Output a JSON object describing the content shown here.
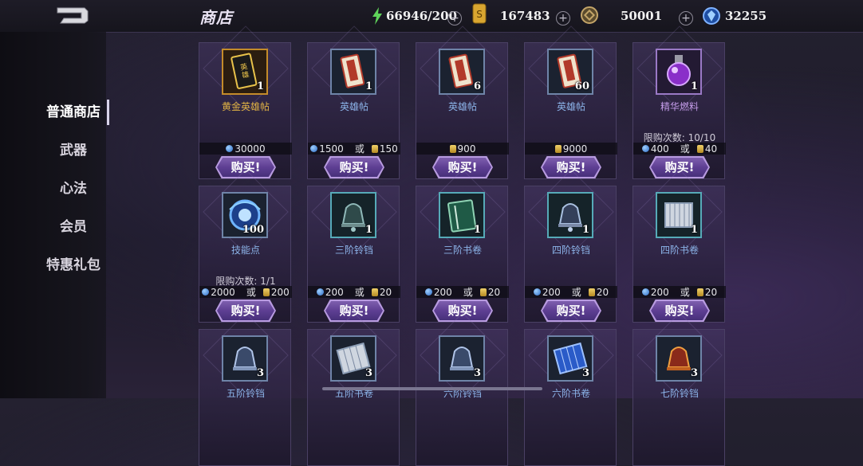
{
  "header": {
    "title": "商店",
    "resources": [
      {
        "icon": "stamina-lightning-icon",
        "value": "66946/200",
        "color": "#5fd35a"
      },
      {
        "icon": "gold-ticket-icon",
        "value": "167483",
        "color": "#d9a630"
      },
      {
        "icon": "copper-coin-icon",
        "value": "50001",
        "color": "#c3a468"
      },
      {
        "icon": "blue-gem-icon",
        "value": "32255",
        "color": "#3a78d8"
      }
    ]
  },
  "sidebar": {
    "items": [
      {
        "label": "普通商店",
        "active": true
      },
      {
        "label": "武器",
        "active": false
      },
      {
        "label": "心法",
        "active": false
      },
      {
        "label": "会员",
        "active": false
      },
      {
        "label": "特惠礼包",
        "active": false
      }
    ]
  },
  "shop": {
    "buy_label": "购买!",
    "or_label": "或",
    "items": [
      {
        "name": "黄金英雄帖",
        "qty": "1",
        "icon": "gold-hero-card-icon",
        "rarity": "gold",
        "limit": "",
        "price_gem": "30000",
        "price_ticket": ""
      },
      {
        "name": "英雄帖",
        "qty": "1",
        "icon": "hero-card-icon",
        "rarity": "blue",
        "limit": "",
        "price_gem": "1500",
        "price_ticket": "150"
      },
      {
        "name": "英雄帖",
        "qty": "6",
        "icon": "hero-card-icon",
        "rarity": "blue",
        "limit": "",
        "price_gem": "",
        "price_ticket": "900"
      },
      {
        "name": "英雄帖",
        "qty": "60",
        "icon": "hero-card-icon",
        "rarity": "blue",
        "limit": "",
        "price_gem": "",
        "price_ticket": "9000"
      },
      {
        "name": "精华燃料",
        "qty": "1",
        "icon": "purple-flask-icon",
        "rarity": "purple",
        "limit": "限购次数: 10/10",
        "price_gem": "400",
        "price_ticket": "40"
      },
      {
        "name": "技能点",
        "qty": "100",
        "icon": "skill-orb-icon",
        "rarity": "blue",
        "limit": "限购次数: 1/1",
        "price_gem": "2000",
        "price_ticket": "200"
      },
      {
        "name": "三阶铃铛",
        "qty": "1",
        "icon": "bell-icon",
        "rarity": "cyan",
        "limit": "",
        "price_gem": "200",
        "price_ticket": "20"
      },
      {
        "name": "三阶书卷",
        "qty": "1",
        "icon": "scroll-book-icon",
        "rarity": "cyan",
        "limit": "",
        "price_gem": "200",
        "price_ticket": "20"
      },
      {
        "name": "四阶铃铛",
        "qty": "1",
        "icon": "bell-icon",
        "rarity": "cyan",
        "limit": "",
        "price_gem": "200",
        "price_ticket": "20"
      },
      {
        "name": "四阶书卷",
        "qty": "1",
        "icon": "scroll-book-icon",
        "rarity": "cyan",
        "limit": "",
        "price_gem": "200",
        "price_ticket": "20"
      },
      {
        "name": "五阶铃铛",
        "qty": "3",
        "icon": "bell-icon",
        "rarity": "blue",
        "limit": "",
        "price_gem": "",
        "price_ticket": ""
      },
      {
        "name": "五阶书卷",
        "qty": "3",
        "icon": "scroll-book-icon",
        "rarity": "blue",
        "limit": "",
        "price_gem": "",
        "price_ticket": ""
      },
      {
        "name": "六阶铃铛",
        "qty": "3",
        "icon": "bell-icon",
        "rarity": "blue",
        "limit": "",
        "price_gem": "",
        "price_ticket": ""
      },
      {
        "name": "六阶书卷",
        "qty": "3",
        "icon": "scroll-book-icon",
        "rarity": "blue",
        "limit": "",
        "price_gem": "",
        "price_ticket": ""
      },
      {
        "name": "七阶铃铛",
        "qty": "3",
        "icon": "red-bell-icon",
        "rarity": "blue",
        "limit": "",
        "price_gem": "",
        "price_ticket": ""
      }
    ]
  }
}
